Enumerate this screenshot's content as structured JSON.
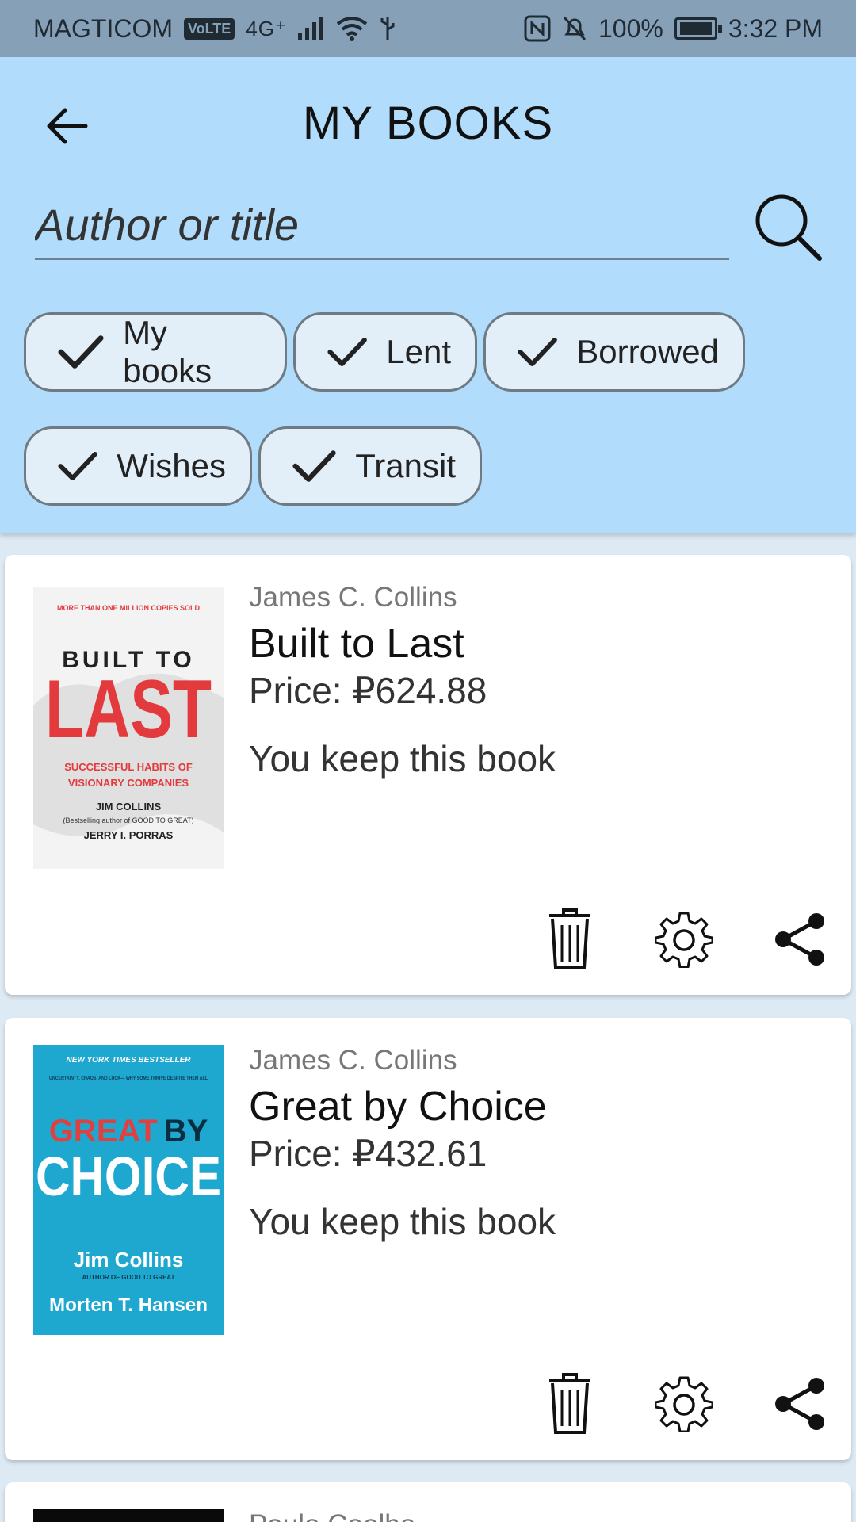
{
  "status_bar": {
    "carrier": "MAGTICOM",
    "volte": "VoLTE",
    "network": "4G⁺",
    "battery": "100%",
    "time": "3:32 PM"
  },
  "header": {
    "title": "MY BOOKS",
    "search_placeholder": "Author or title"
  },
  "filters": [
    {
      "label": "My books",
      "checked": true
    },
    {
      "label": "Lent",
      "checked": true
    },
    {
      "label": "Borrowed",
      "checked": true
    },
    {
      "label": "Wishes",
      "checked": true
    },
    {
      "label": "Transit",
      "checked": true
    }
  ],
  "books": [
    {
      "author": "James C. Collins",
      "title": "Built to Last",
      "price": "Price: ₽624.88",
      "status": "You keep this book",
      "cover": {
        "top_line": "MORE THAN ONE MILLION COPIES SOLD",
        "line1": "BUILT TO",
        "line2": "LAST",
        "sub1": "SUCCESSFUL HABITS OF",
        "sub2": "VISIONARY COMPANIES",
        "author1": "JIM COLLINS",
        "note": "(Bestselling author of GOOD TO GREAT)",
        "author2": "JERRY I. PORRAS"
      }
    },
    {
      "author": "James C. Collins",
      "title": "Great by Choice",
      "price": "Price: ₽432.61",
      "status": "You keep this book",
      "cover": {
        "top_line": "NEW YORK TIMES BESTSELLER",
        "tagline": "UNCERTAINTY, CHAOS, AND LUCK— WHY SOME THRIVE DESPITE THEM ALL",
        "word1": "GREAT",
        "word2": "BY",
        "line2": "CHOICE",
        "author1": "Jim Collins",
        "note": "AUTHOR OF GOOD TO GREAT",
        "author2": "Morten T. Hansen"
      }
    },
    {
      "author": "Paulo Coelho"
    }
  ],
  "colors": {
    "header_bg": "#b1dcfb",
    "status_bar_bg": "#86a0b8",
    "page_bg": "#dde9f3",
    "cover1_red": "#e23a3d",
    "cover2_bg": "#1ea8d0"
  }
}
